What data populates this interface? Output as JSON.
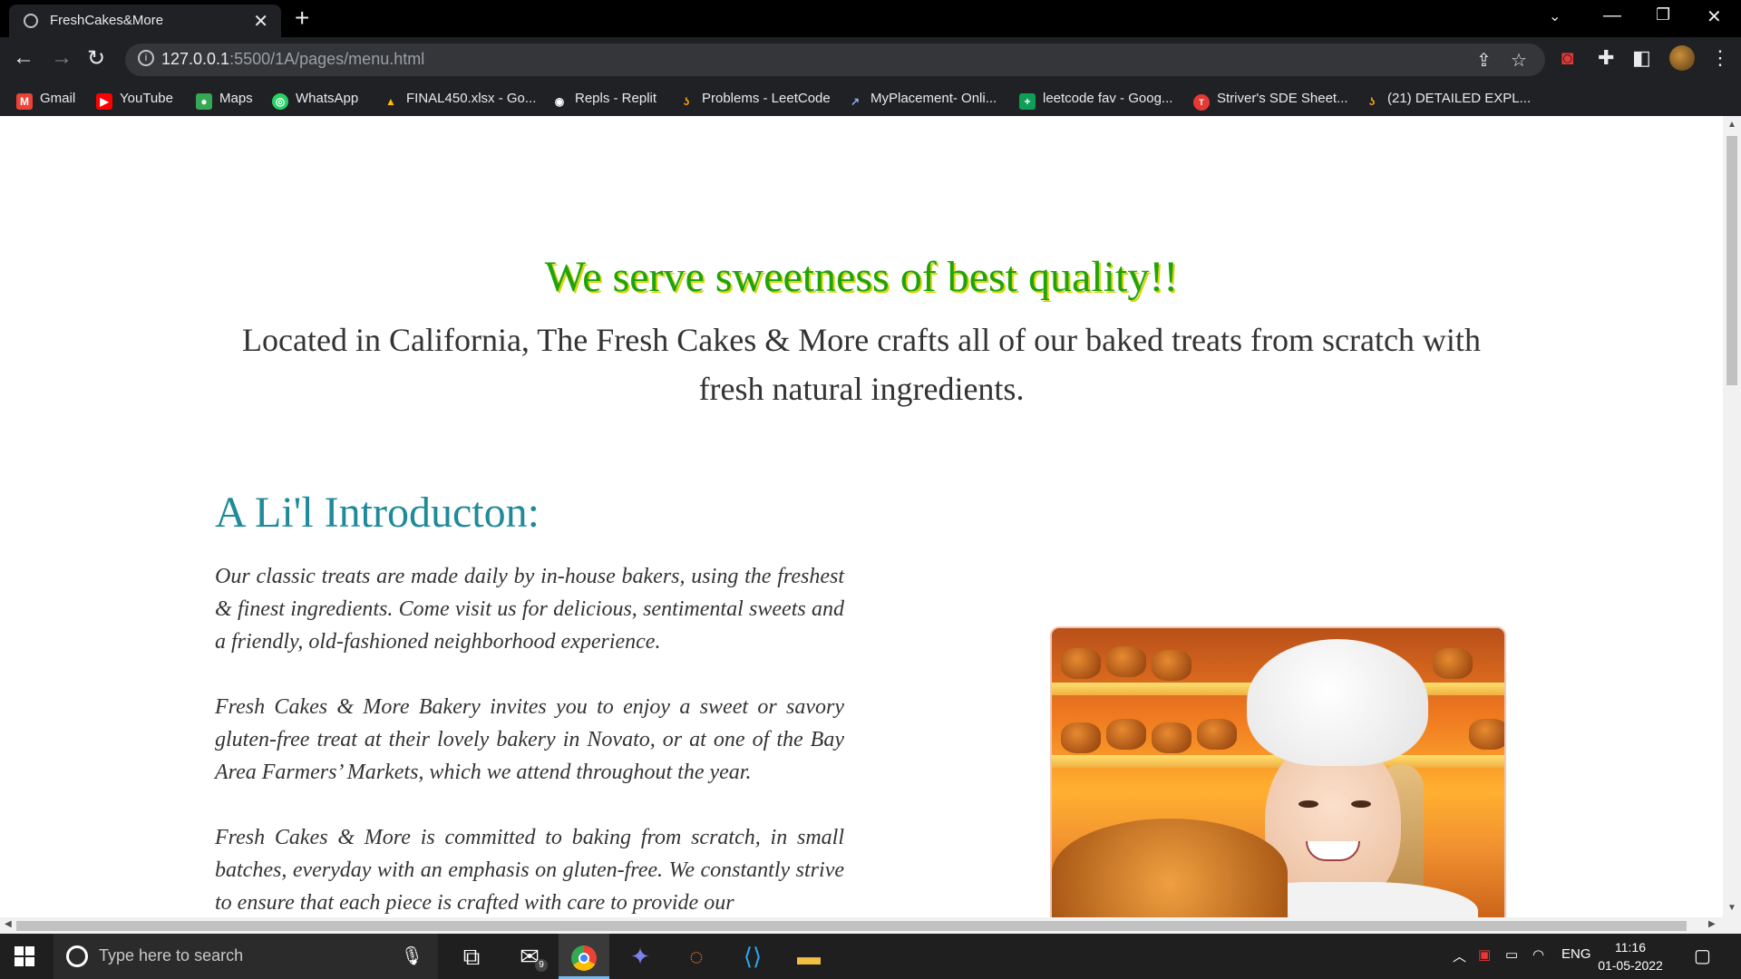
{
  "browser": {
    "tab_title": "FreshCakes&More",
    "url_host": "127.0.0.1",
    "url_path": ":5500/1A/pages/menu.html",
    "bookmarks": [
      {
        "label": "Gmail",
        "icon": "gmail-icon",
        "color": "#ea4335",
        "glyph": "M"
      },
      {
        "label": "YouTube",
        "icon": "youtube-icon",
        "color": "#ff0000",
        "glyph": "▶"
      },
      {
        "label": "Maps",
        "icon": "maps-icon",
        "color": "#34a853",
        "glyph": "●"
      },
      {
        "label": "WhatsApp",
        "icon": "whatsapp-icon",
        "color": "#25d366",
        "glyph": "◎"
      },
      {
        "label": "FINAL450.xlsx - Go...",
        "icon": "google-drive-icon",
        "color": "#fbbc04",
        "glyph": "▲"
      },
      {
        "label": "Repls - Replit",
        "icon": "replit-icon",
        "color": "#555555",
        "glyph": "◉"
      },
      {
        "label": "Problems - LeetCode",
        "icon": "leetcode-icon",
        "color": "#ffa116",
        "glyph": "ʖ"
      },
      {
        "label": "MyPlacement- Onli...",
        "icon": "external-link-icon",
        "color": "#4a90d9",
        "glyph": "↗"
      },
      {
        "label": "leetcode fav - Goog...",
        "icon": "google-sheets-icon",
        "color": "#0f9d58",
        "glyph": "+"
      },
      {
        "label": "Striver's SDE Sheet...",
        "icon": "tuf-icon",
        "color": "#e53935",
        "glyph": "T"
      },
      {
        "label": "(21) DETAILED EXPL...",
        "icon": "leetcode-icon",
        "color": "#ffa116",
        "glyph": "ʖ"
      }
    ]
  },
  "page": {
    "hero_title": "We serve sweetness of best quality!!",
    "hero_subtitle": "Located in California, The Fresh Cakes & More crafts all of our baked treats from scratch with fresh natural ingredients.",
    "intro_heading": "A Li'l Introducton:",
    "paragraphs": [
      "Our classic treats are made daily by in-house bakers, using the freshest & finest ingredients. Come visit us for delicious, sentimental sweets and a friendly, old-fashioned neighborhood experience.",
      "Fresh Cakes & More Bakery invites you to enjoy a sweet or savory gluten-free treat at their lovely bakery in Novato, or at one of the Bay Area Farmers’ Markets, which we attend throughout the year.",
      "Fresh Cakes & More is committed to baking from scratch, in small batches, everyday with an emphasis on gluten-free. We constantly strive to ensure that each piece is crafted with care to provide our"
    ],
    "colors": {
      "hero": "#1ea30f",
      "heading": "#1f8a99",
      "text": "#333333"
    }
  },
  "taskbar": {
    "search_placeholder": "Type here to search",
    "mail_badge": "9",
    "language": "ENG",
    "time": "11:16",
    "date": "01-05-2022"
  }
}
